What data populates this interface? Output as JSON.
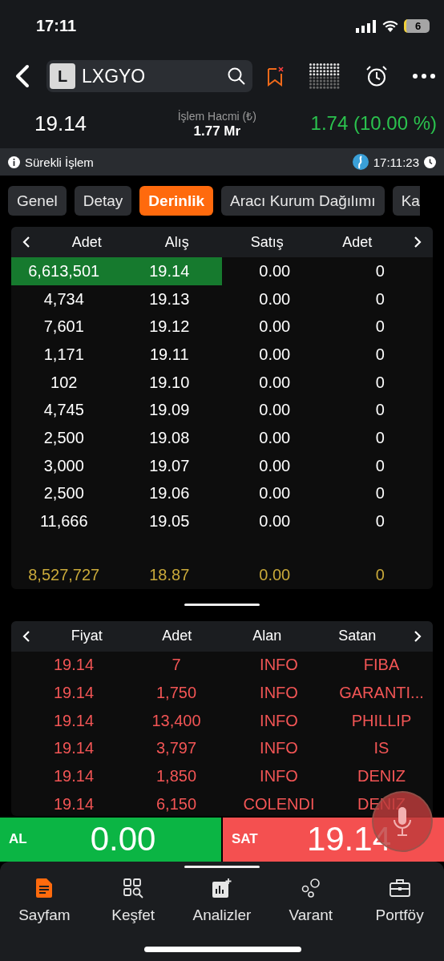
{
  "status_bar": {
    "time": "17:11",
    "battery": "6"
  },
  "header": {
    "symbol_badge": "L",
    "symbol": "LXGYO"
  },
  "quote": {
    "price": "19.14",
    "volume_label": "İşlem Hacmi (₺)",
    "volume": "1.77 Mr",
    "change": "1.74 (10.00 %)"
  },
  "session": {
    "label": "Sürekli İşlem",
    "time": "17:11:23"
  },
  "tabs": [
    {
      "label": "Genel",
      "selected": false
    },
    {
      "label": "Detay",
      "selected": false
    },
    {
      "label": "Derinlik",
      "selected": true
    },
    {
      "label": "Aracı Kurum Dağılımı",
      "selected": false
    },
    {
      "label": "Ka",
      "selected": false
    }
  ],
  "depth": {
    "columns": [
      "Adet",
      "Alış",
      "Satış",
      "Adet"
    ],
    "rows": [
      {
        "cells": [
          "6,613,501",
          "19.14",
          "0.00",
          "0"
        ],
        "highlighted": true
      },
      {
        "cells": [
          "4,734",
          "19.13",
          "0.00",
          "0"
        ],
        "highlighted": false
      },
      {
        "cells": [
          "7,601",
          "19.12",
          "0.00",
          "0"
        ],
        "highlighted": false
      },
      {
        "cells": [
          "1,171",
          "19.11",
          "0.00",
          "0"
        ],
        "highlighted": false
      },
      {
        "cells": [
          "102",
          "19.10",
          "0.00",
          "0"
        ],
        "highlighted": false
      },
      {
        "cells": [
          "4,745",
          "19.09",
          "0.00",
          "0"
        ],
        "highlighted": false
      },
      {
        "cells": [
          "2,500",
          "19.08",
          "0.00",
          "0"
        ],
        "highlighted": false
      },
      {
        "cells": [
          "3,000",
          "19.07",
          "0.00",
          "0"
        ],
        "highlighted": false
      },
      {
        "cells": [
          "2,500",
          "19.06",
          "0.00",
          "0"
        ],
        "highlighted": false
      },
      {
        "cells": [
          "11,666",
          "19.05",
          "0.00",
          "0"
        ],
        "highlighted": false
      }
    ],
    "total": [
      "8,527,727",
      "18.87",
      "0.00",
      "0"
    ]
  },
  "trades": {
    "columns": [
      "Fiyat",
      "Adet",
      "Alan",
      "Satan"
    ],
    "rows": [
      [
        "19.14",
        "7",
        "INFO",
        "FIBA"
      ],
      [
        "19.14",
        "1,750",
        "INFO",
        "GARANTI..."
      ],
      [
        "19.14",
        "13,400",
        "INFO",
        "PHILLIP"
      ],
      [
        "19.14",
        "3,797",
        "INFO",
        "IS"
      ],
      [
        "19.14",
        "1,850",
        "INFO",
        "DENIZ"
      ],
      [
        "19.14",
        "6,150",
        "COLENDI",
        "DENIZ"
      ]
    ]
  },
  "order_bar": {
    "buy_label": "AL",
    "buy_price": "0.00",
    "sell_label": "SAT",
    "sell_price": "19.14"
  },
  "nav": [
    {
      "label": "Sayfam",
      "kind": "page",
      "selected": true
    },
    {
      "label": "Keşfet",
      "kind": "discover",
      "selected": false
    },
    {
      "label": "Analizler",
      "kind": "analysis",
      "selected": false
    },
    {
      "label": "Varant",
      "kind": "warrant",
      "selected": false
    },
    {
      "label": "Portföy",
      "kind": "portfolio",
      "selected": false
    }
  ]
}
